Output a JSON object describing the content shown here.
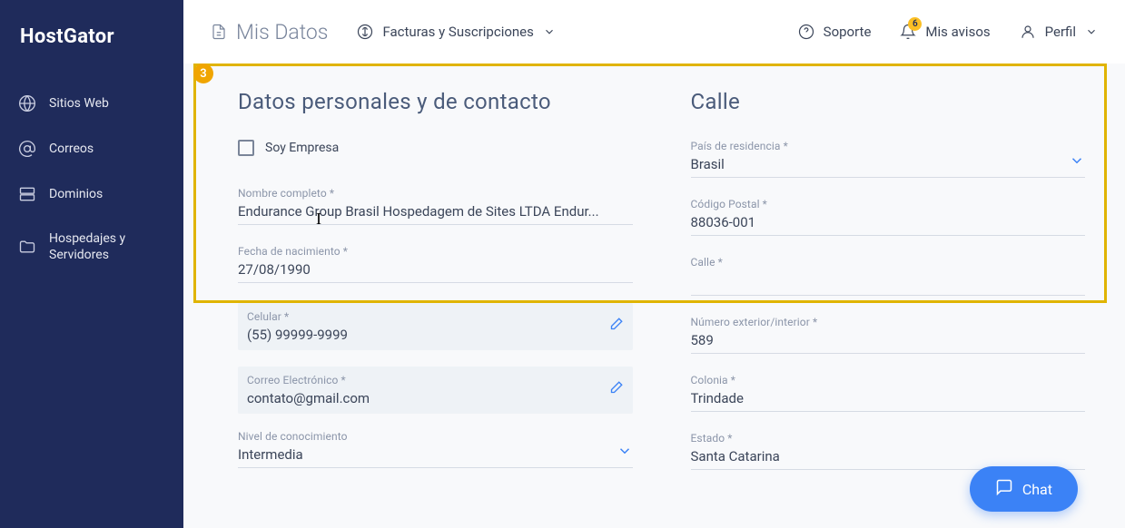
{
  "logo": "HostGator",
  "sidebar": {
    "items": [
      {
        "label": "Sitios Web"
      },
      {
        "label": "Correos"
      },
      {
        "label": "Dominios"
      },
      {
        "label": "Hospedajes y Servidores"
      }
    ]
  },
  "topbar": {
    "current": "Mis Datos",
    "billing": "Facturas y Suscripciones",
    "support": "Soporte",
    "notices": "Mis avisos",
    "notices_badge": "6",
    "profile": "Perfil"
  },
  "highlight": {
    "num": "3"
  },
  "left": {
    "title": "Datos personales y de contacto",
    "company_check": "Soy Empresa",
    "name_label": "Nombre completo *",
    "name_value": "Endurance Group Brasil Hospedagem de Sites LTDA Endur...",
    "dob_label": "Fecha de nacimiento *",
    "dob_value": "27/08/1990",
    "phone_label": "Celular *",
    "phone_value": "(55) 99999-9999",
    "email_label": "Correo Electrónico *",
    "email_value": "contato@gmail.com",
    "level_label": "Nivel de conocimiento",
    "level_value": "Intermedia"
  },
  "right": {
    "title": "Calle",
    "country_label": "País de residencia *",
    "country_value": "Brasil",
    "postal_label": "Código Postal *",
    "postal_value": "88036-001",
    "street_label": "Calle *",
    "street_value": "",
    "number_label": "Número exterior/interior *",
    "number_value": "589",
    "colony_label": "Colonia *",
    "colony_value": "Trindade",
    "state_label": "Estado *",
    "state_value": "Santa Catarina"
  },
  "chat": "Chat"
}
